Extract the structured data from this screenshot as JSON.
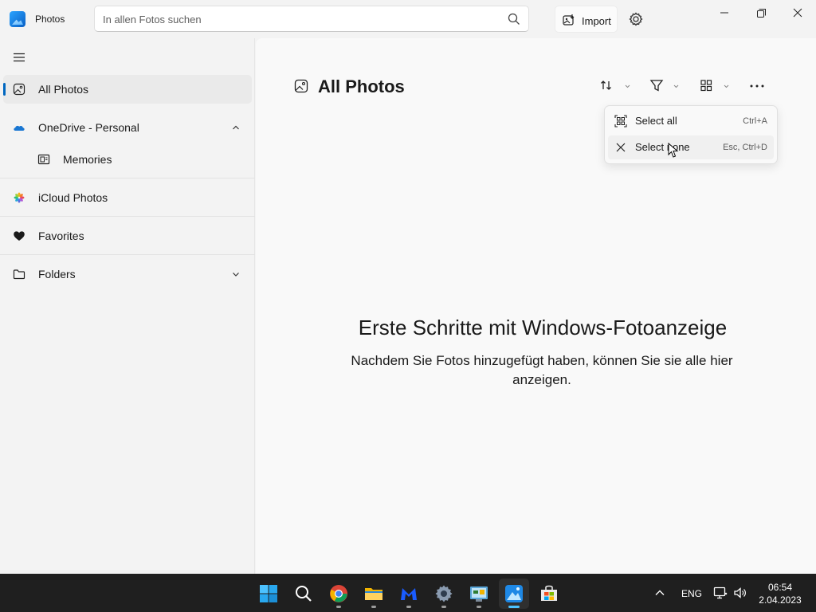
{
  "titlebar": {
    "app_title": "Photos",
    "search_placeholder": "In allen Fotos suchen",
    "import_label": "Import"
  },
  "sidebar": {
    "items": [
      {
        "label": "All Photos",
        "icon": "photo-icon",
        "selected": true
      },
      {
        "label": "OneDrive - Personal",
        "icon": "onedrive-cloud-icon",
        "expanded": true
      },
      {
        "label": "Memories",
        "icon": "memories-icon",
        "indent": true
      },
      {
        "label": "iCloud Photos",
        "icon": "icloud-photos-icon"
      },
      {
        "label": "Favorites",
        "icon": "heart-icon"
      },
      {
        "label": "Folders",
        "icon": "folder-icon",
        "expanded": false
      }
    ]
  },
  "main": {
    "title": "All Photos",
    "menu": {
      "items": [
        {
          "label": "Select all",
          "shortcut": "Ctrl+A",
          "icon": "select-all-icon"
        },
        {
          "label": "Select none",
          "shortcut": "Esc, Ctrl+D",
          "icon": "close-icon"
        }
      ]
    },
    "empty_title": "Erste Schritte mit Windows-Fotoanzeige",
    "empty_desc": "Nachdem Sie Fotos hinzugefügt haben, können Sie sie alle hier anzeigen."
  },
  "taskbar": {
    "apps": [
      "start-icon",
      "search-icon",
      "chrome-icon",
      "file-explorer-icon",
      "malwarebytes-icon",
      "settings-icon",
      "control-panel-icon",
      "photos-icon",
      "store-icon"
    ],
    "language": "ENG",
    "time": "06:54",
    "date": "2.04.2023"
  },
  "colors": {
    "accent": "#0067c0",
    "taskbar": "#1f1f1f",
    "active_indicator": "#4cc2ff"
  }
}
